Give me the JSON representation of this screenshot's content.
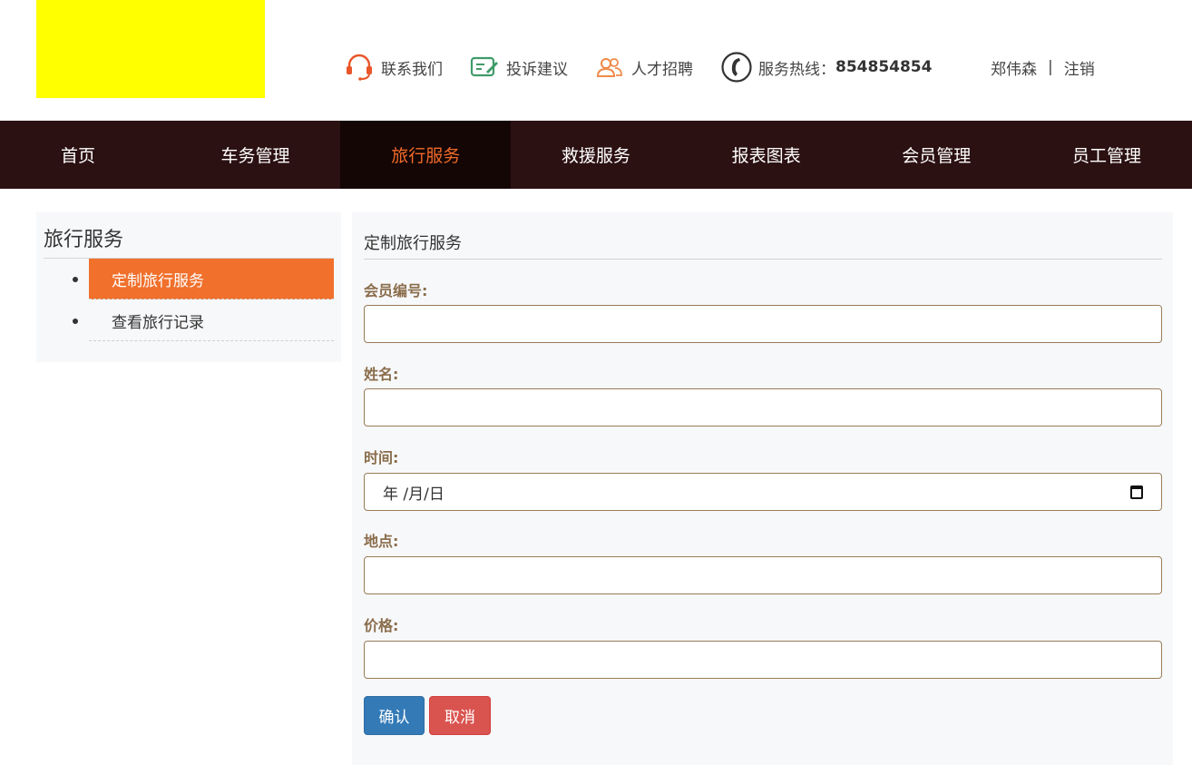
{
  "header": {
    "links": [
      {
        "label": "联系我们",
        "icon": "headset-icon"
      },
      {
        "label": "投诉建议",
        "icon": "feedback-icon"
      },
      {
        "label": "人才招聘",
        "icon": "people-icon"
      }
    ],
    "hotline_label": "服务热线：",
    "hotline_number": "854854854",
    "user_name": "郑伟森",
    "separator": "|",
    "logout_label": "注销",
    "logo_color": "#ffff00"
  },
  "nav": {
    "items": [
      "首页",
      "车务管理",
      "旅行服务",
      "救援服务",
      "报表图表",
      "会员管理",
      "员工管理"
    ],
    "active_index": 2
  },
  "sidebar": {
    "title": "旅行服务",
    "items": [
      {
        "label": "定制旅行服务",
        "active": true
      },
      {
        "label": "查看旅行记录",
        "active": false
      }
    ]
  },
  "form": {
    "title": "定制旅行服务",
    "fields": [
      {
        "label": "会员编号:",
        "value": ""
      },
      {
        "label": "姓名:",
        "value": ""
      },
      {
        "label": "时间:",
        "value": "",
        "placeholder": "年 /月/日"
      },
      {
        "label": "地点:",
        "value": ""
      },
      {
        "label": "价格:",
        "value": ""
      }
    ],
    "confirm_label": "确认",
    "cancel_label": "取消"
  },
  "colors": {
    "nav_bg": "#2c1112",
    "nav_active_bg": "#140604",
    "accent": "#f06a2a",
    "label": "#8a6d4b",
    "confirm": "#337ab7",
    "cancel": "#d9534f"
  }
}
